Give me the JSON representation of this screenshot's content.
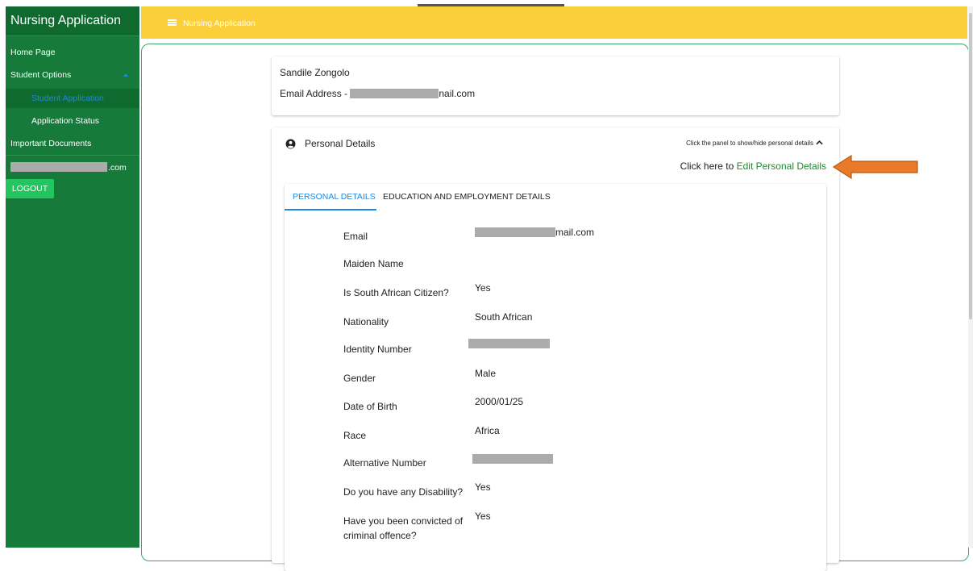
{
  "app": {
    "title": "Nursing Application"
  },
  "sidebar": {
    "items": [
      {
        "label": "Home Page"
      },
      {
        "label": "Student Options"
      },
      {
        "label": "Student Application"
      },
      {
        "label": "Application Status"
      },
      {
        "label": "Important Documents"
      }
    ],
    "user_email_suffix": ".com",
    "logout_label": "LOGOUT"
  },
  "topbar": {
    "title": "Nursing Application"
  },
  "profile": {
    "name": "Sandile Zongolo",
    "email_prefix": "Email Address - ",
    "email_suffix": "nail.com"
  },
  "personal_panel": {
    "heading": "Personal Details",
    "toggle_hint": "Click the panel to show/hide personal details",
    "edit_prefix": "Click here to ",
    "edit_link": "Edit Personal Details"
  },
  "tabs": [
    {
      "label": "PERSONAL DETAILS",
      "active": true
    },
    {
      "label": "EDUCATION AND EMPLOYMENT DETAILS",
      "active": false
    }
  ],
  "details": [
    {
      "label": "Email",
      "value": "mail.com"
    },
    {
      "label": "Maiden Name",
      "value": ""
    },
    {
      "label": "Is South African Citizen?",
      "value": "Yes"
    },
    {
      "label": "Nationality",
      "value": "South African"
    },
    {
      "label": "Identity Number",
      "value": ""
    },
    {
      "label": "Gender",
      "value": "Male"
    },
    {
      "label": "Date of Birth",
      "value": "2000/01/25"
    },
    {
      "label": "Race",
      "value": "Africa"
    },
    {
      "label": "Alternative Number",
      "value": ""
    },
    {
      "label": "Do you have any Disability?",
      "value": "Yes"
    },
    {
      "label_line1": "Have you been convicted of",
      "label_line2": "criminal offence?",
      "value": "Yes"
    }
  ],
  "colors": {
    "sidebar_green": "#157a3a",
    "topbar_yellow": "#fbcf3a",
    "tab_blue": "#1e88e5",
    "link_green": "#1f8a2e",
    "logout_green": "#22c55e",
    "arrow_orange": "#e87a2a"
  },
  "icons": [
    "menu-icon",
    "chevron-up-icon",
    "account-circle-icon",
    "left-arrow-annotation-icon"
  ]
}
